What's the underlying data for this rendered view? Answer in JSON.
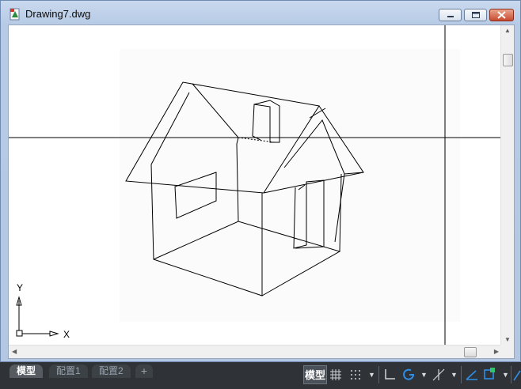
{
  "window": {
    "title": "Drawing7.dwg",
    "icon": "autocad-drawing-icon",
    "controls": {
      "minimize": "minimize-icon",
      "maximize": "maximize-icon",
      "close": "close-icon"
    }
  },
  "viewport": {
    "ucs_y_label": "Y",
    "ucs_x_label": "X"
  },
  "layout_tabs": [
    {
      "label": "模型",
      "active": true
    },
    {
      "label": "配置1",
      "active": false
    },
    {
      "label": "配置2",
      "active": false
    },
    {
      "label": "+",
      "active": false
    }
  ],
  "statusbar": {
    "model_label": "模型",
    "icons": [
      "grid-icon",
      "snap-icon",
      "dropdown-icon",
      "ortho-icon",
      "polar-icon",
      "dropdown-icon",
      "isodraft-icon",
      "dropdown-icon",
      "osnap-icon",
      "dynamic-ucs-icon",
      "dropdown-icon",
      "annotation-icon"
    ]
  }
}
